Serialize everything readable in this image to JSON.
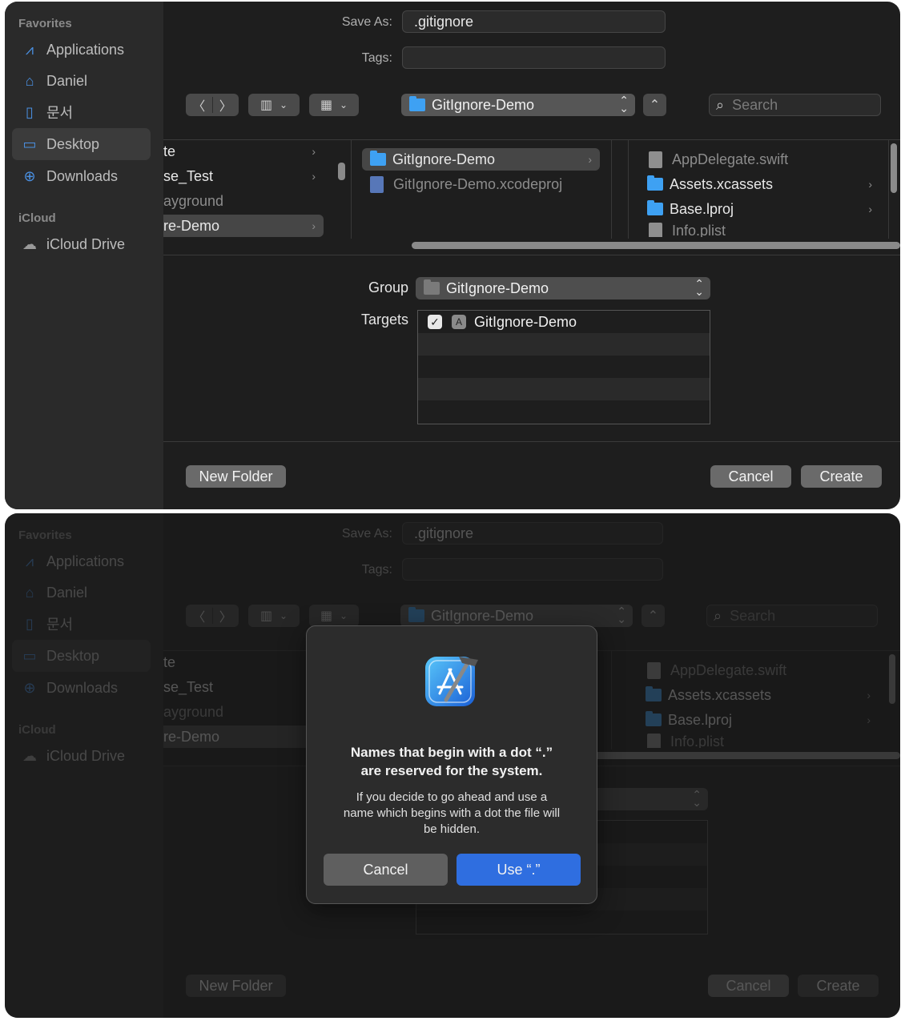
{
  "dialog": {
    "sidebar": {
      "favorites_heading": "Favorites",
      "items": [
        {
          "label": "Applications",
          "icon": "applications-icon"
        },
        {
          "label": "Daniel",
          "icon": "home-icon"
        },
        {
          "label": "문서",
          "icon": "document-icon"
        },
        {
          "label": "Desktop",
          "icon": "desktop-icon"
        },
        {
          "label": "Downloads",
          "icon": "downloads-icon"
        }
      ],
      "icloud_heading": "iCloud",
      "icloud_items": [
        {
          "label": "iCloud Drive",
          "icon": "cloud-icon"
        }
      ],
      "selected": "Desktop"
    },
    "save_as_label": "Save As:",
    "save_as_value": ".gitignore",
    "tags_label": "Tags:",
    "location": "GitIgnore-Demo",
    "search_placeholder": "Search",
    "browser": {
      "col1": [
        "te",
        "se_Test",
        "ayground",
        "re-Demo"
      ],
      "col2": [
        {
          "label": "GitIgnore-Demo",
          "kind": "folder"
        },
        {
          "label": "GitIgnore-Demo.xcodeproj",
          "kind": "xcodeproj"
        }
      ],
      "col3": [
        {
          "label": "AppDelegate.swift",
          "kind": "file"
        },
        {
          "label": "Assets.xcassets",
          "kind": "folder"
        },
        {
          "label": "Base.lproj",
          "kind": "folder"
        },
        {
          "label": "Info.plist",
          "kind": "file"
        }
      ]
    },
    "group_label": "Group",
    "group_value": "GitIgnore-Demo",
    "targets_label": "Targets",
    "targets": [
      {
        "label": "GitIgnore-Demo",
        "checked": true
      }
    ],
    "new_folder_label": "New Folder",
    "cancel_label": "Cancel",
    "create_label": "Create"
  },
  "alert": {
    "title_line1": "Names that begin with a dot “.”",
    "title_line2": "are reserved for the system.",
    "message_line1": "If you decide to go ahead and use a",
    "message_line2": "name which begins with a dot the file will",
    "message_line3": "be hidden.",
    "cancel_label": "Cancel",
    "use_label": "Use “.”",
    "icon": "xcode-icon"
  },
  "colors": {
    "accent": "#2f6ee0",
    "folder": "#3ea1f3",
    "window_bg": "#1e1e1e",
    "sidebar_bg": "#2a2a2a"
  }
}
